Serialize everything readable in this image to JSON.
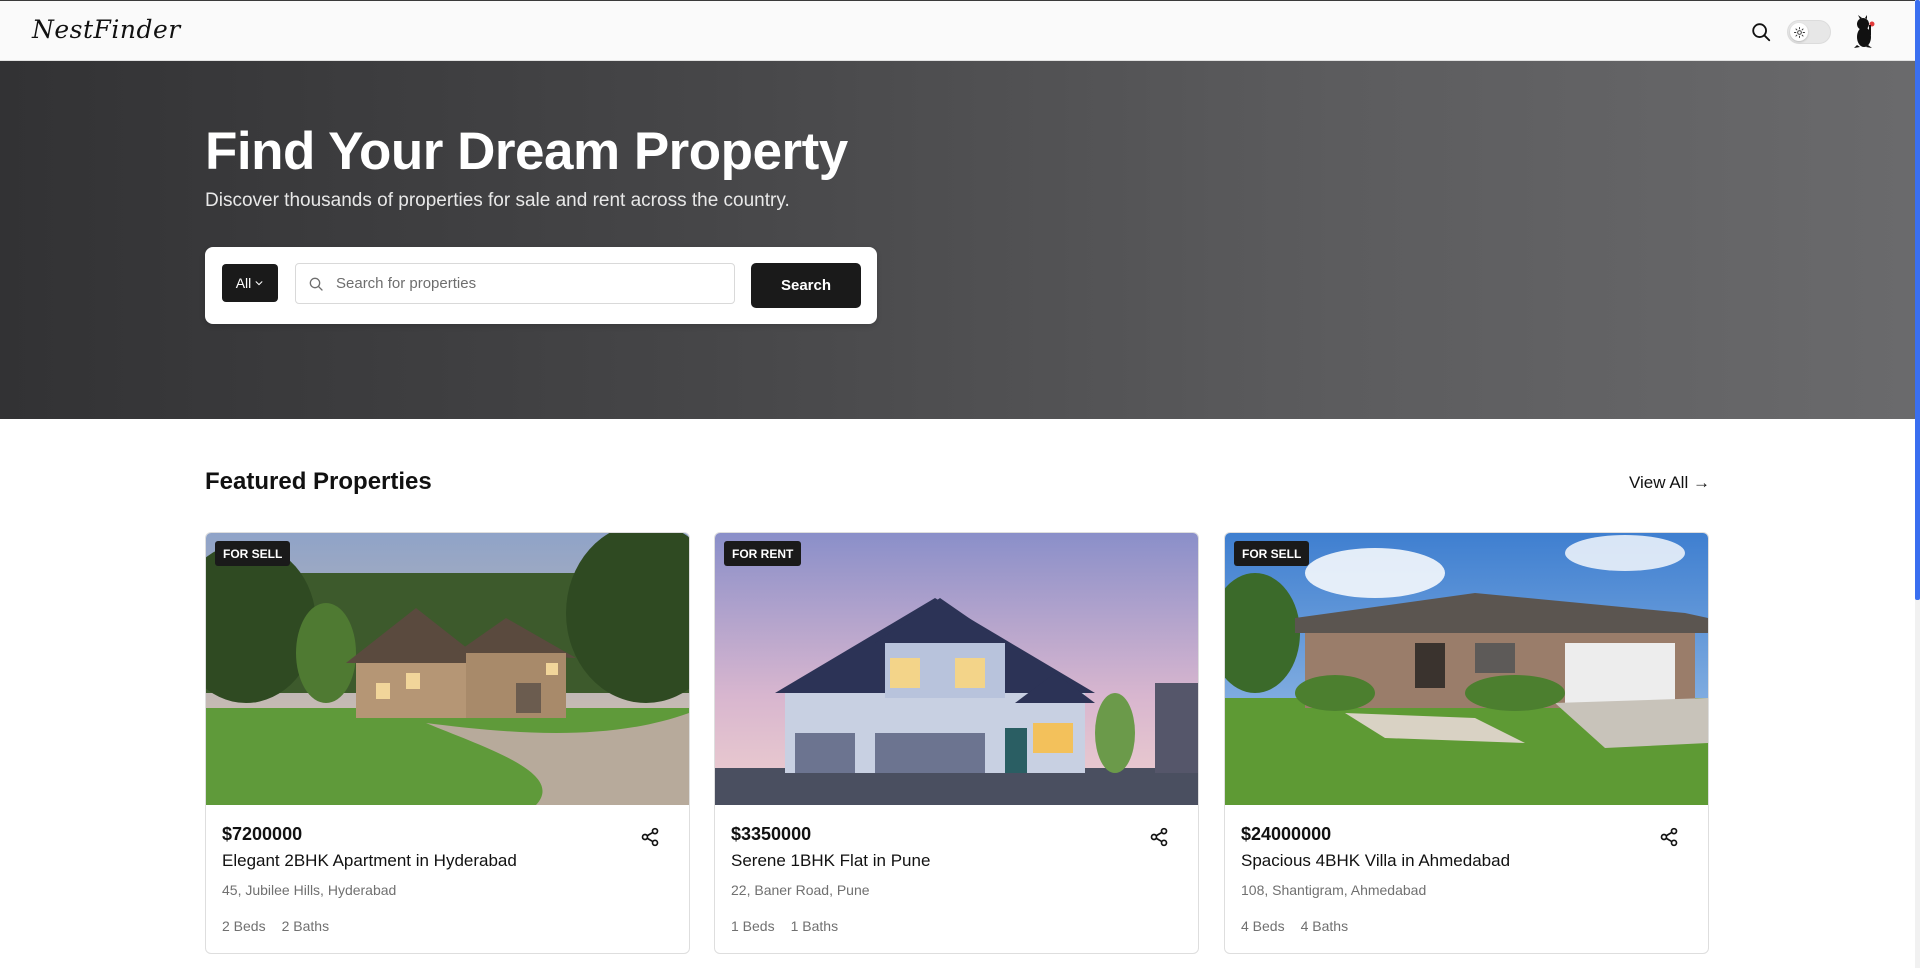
{
  "header": {
    "logo_text": "NestFinder",
    "search_icon": "search-icon",
    "theme_toggle_icon": "sun-icon",
    "avatar_icon": "user-avatar"
  },
  "hero": {
    "title": "Find Your Dream Property",
    "subtitle": "Discover thousands of properties for sale and rent across the country.",
    "filter_value": "All",
    "search_placeholder": "Search for properties",
    "search_button": "Search"
  },
  "featured": {
    "title": "Featured Properties",
    "view_all": "View All →",
    "cards": [
      {
        "badge": "FOR SELL",
        "price": "$7200000",
        "title": "Elegant 2BHK Apartment in Hyderabad",
        "address": "45, Jubilee Hills, Hyderabad",
        "beds": "2 Beds",
        "baths": "2 Baths"
      },
      {
        "badge": "FOR RENT",
        "price": "$3350000",
        "title": "Serene 1BHK Flat in Pune",
        "address": "22, Baner Road, Pune",
        "beds": "1 Beds",
        "baths": "1 Baths"
      },
      {
        "badge": "FOR SELL",
        "price": "$24000000",
        "title": "Spacious 4BHK Villa in Ahmedabad",
        "address": "108, Shantigram, Ahmedabad",
        "beds": "4 Beds",
        "baths": "4 Baths"
      }
    ]
  },
  "colors": {
    "primary_dark": "#1a1a1a",
    "hero_gradient_start": "#323234",
    "hero_gradient_end": "#6a6a6c",
    "scrollbar_accent": "#3a6ff0"
  }
}
